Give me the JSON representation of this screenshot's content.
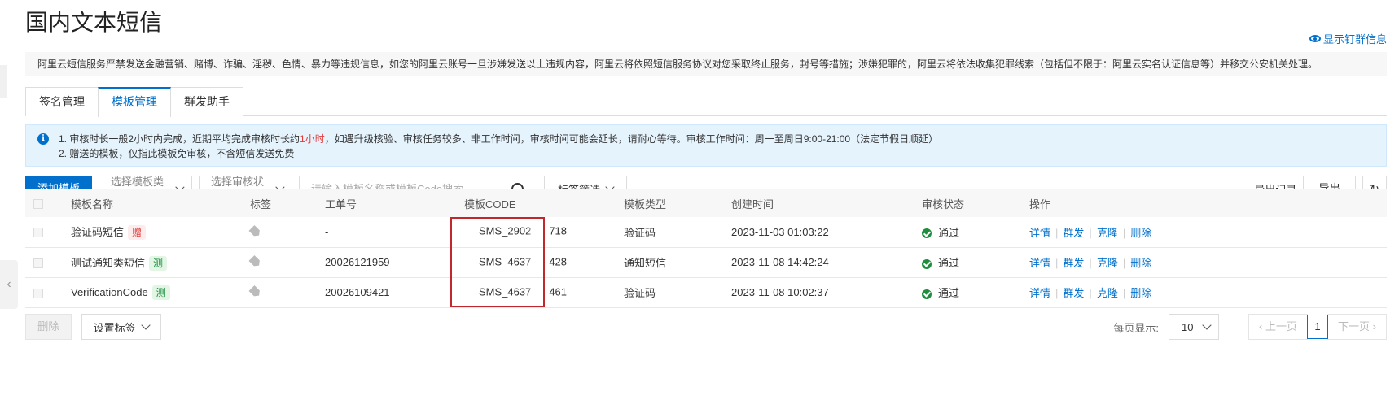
{
  "page": {
    "title": "国内文本短信",
    "show_signature_group": "显示钉群信息"
  },
  "notice": "阿里云短信服务严禁发送金融营销、赌博、诈骗、淫秽、色情、暴力等违规信息，如您的阿里云账号一旦涉嫌发送以上违规内容，阿里云将依照短信服务协议对您采取终止服务，封号等措施；涉嫌犯罪的，阿里云将依法收集犯罪线索（包括但不限于：阿里云实名认证信息等）并移交公安机关处理。",
  "tabs": [
    {
      "label": "签名管理",
      "active": false
    },
    {
      "label": "模板管理",
      "active": true
    },
    {
      "label": "群发助手",
      "active": false
    }
  ],
  "info": {
    "line1_prefix": "1. 审核时长一般2小时内完成，近期平均完成审核时长约",
    "line1_highlight": "1小时",
    "line1_suffix": "，如遇升级核验、审核任务较多、非工作时间，审核时间可能会延长，请耐心等待。审核工作时间：周一至周日9:00-21:00（法定节假日顺延）",
    "line2": "2. 赠送的模板，仅指此模板免审核，不含短信发送免费"
  },
  "toolbar": {
    "add_template": "添加模板",
    "type_select": "选择模板类型",
    "status_select": "选择审核状态",
    "search_placeholder": "请输入模板名称或模板Code搜索",
    "tag_filter": "标签筛选",
    "export_records": "导出记录",
    "export": "导出"
  },
  "table": {
    "headers": [
      "模板名称",
      "标签",
      "工单号",
      "模板CODE",
      "模板类型",
      "创建时间",
      "审核状态",
      "操作"
    ],
    "rows": [
      {
        "name": "验证码短信",
        "badge": "赠",
        "badge_color": "#e43a3a",
        "ticket": "-",
        "code_pre": "SMS_2902",
        "code_post": "718",
        "type": "验证码",
        "created": "2023-11-03 01:03:22",
        "status": "通过"
      },
      {
        "name": "测试通知类短信",
        "badge": "测",
        "badge_color": "#1e8e3e",
        "ticket": "20026121959",
        "code_pre": "SMS_4637",
        "code_post": "428",
        "type": "通知短信",
        "created": "2023-11-08 14:42:24",
        "status": "通过"
      },
      {
        "name": "VerificationCode",
        "badge": "测",
        "badge_color": "#1e8e3e",
        "ticket": "20026109421",
        "code_pre": "SMS_4637",
        "code_post": "461",
        "type": "验证码",
        "created": "2023-11-08 10:02:37",
        "status": "通过"
      }
    ],
    "ops": [
      "详情",
      "群发",
      "克隆",
      "删除"
    ]
  },
  "footer": {
    "delete": "删除",
    "set_tag": "设置标签",
    "per_page_label": "每页显示:",
    "per_page": "10",
    "prev": "上一页",
    "current_page": "1",
    "next": "下一页"
  },
  "colors": {
    "accent": "#0070cc",
    "success": "#1e8e3e",
    "danger": "#e43a3a",
    "highlight_box": "#c0282d"
  }
}
